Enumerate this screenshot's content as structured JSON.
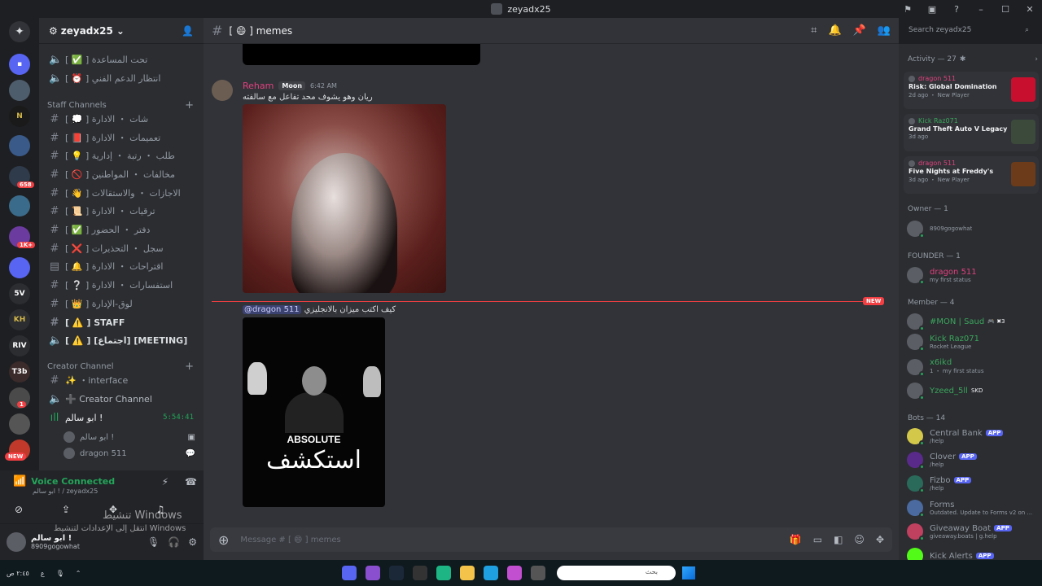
{
  "window": {
    "title": "zeyadx25",
    "controls": [
      "–",
      "☐",
      "✕"
    ]
  },
  "server_list": {
    "badges": [
      "658",
      "1K+",
      "1",
      "NEW"
    ],
    "labels": [
      "5V",
      "KH",
      "RIV",
      "T3b"
    ]
  },
  "guild": {
    "name": "zeyadx25",
    "channels_top": [
      {
        "type": "voice",
        "label": "[ ✅ ] تحت المساعدة"
      },
      {
        "type": "voice",
        "label": "[ ⏰ ] انتظار الدعم الفني"
      }
    ],
    "staff_category": "Staff Channels",
    "staff_channels": [
      {
        "label": "[ 💭 ] شات ・ الادارة"
      },
      {
        "label": "[ 📕 ] تعميمات ・ الادارة"
      },
      {
        "label": "[ 💡 ] طلب ・ رتبة ・ إدارية"
      },
      {
        "label": "[ 🚫 ] مخالفات ・ المواطنين"
      },
      {
        "label": "[ 👋 ] الاجازات ・ والاستقالات"
      },
      {
        "label": "[ 📜 ] ترقيات ・ الادارة"
      },
      {
        "label": "[ ✅ ] دفتر ・ الحضور"
      },
      {
        "label": "[ ❌ ] سجل ・ التحذيرات"
      },
      {
        "label": "[ 🔔 ] اقتراحات ・ الادارة"
      },
      {
        "label": "[ ❔ ] استفسارات ・ الادارة"
      },
      {
        "label": "[ 👑 ] لوق-الإدارة"
      },
      {
        "label": "[ ⚠️ ] STAFF"
      },
      {
        "label": "[ ⚠️ ] [اجتماع] [MEETING]"
      }
    ],
    "creator_category": "Creator Channel",
    "creator_channels": [
      {
        "type": "text",
        "label": "✨ ・interface"
      },
      {
        "type": "voice",
        "label": "➕ Creator Channel"
      },
      {
        "type": "voice-active",
        "label": "ابو سالم !",
        "timer": "5:54:41"
      }
    ],
    "voice_users": [
      {
        "name": "ابو سالم !"
      },
      {
        "name": "dragon 511"
      }
    ]
  },
  "voice_panel": {
    "status": "Voice Connected",
    "sub": "ابو سالم ! / zeyadx25"
  },
  "user_panel": {
    "name": "ابو سالم !",
    "status": "8909gogowhat"
  },
  "channel": {
    "name": "[ 😄 ] memes",
    "search_placeholder": "Search zeyadx25",
    "composer_placeholder": "Message # [ 😄 ] memes"
  },
  "messages": [
    {
      "author": "Reham",
      "role_tag": "Moon",
      "time": "6:42 AM",
      "text": "ريان وهو يشوف محد تفاعل مع سالفته"
    },
    {
      "mention": "@dragon 511",
      "text": "كيف اكتب ميزان بالانجليزي",
      "image_line1": "ABSOLUTE",
      "image_line2": "استكشف"
    }
  ],
  "new_tag": "NEW",
  "activity": {
    "title": "Activity — 27",
    "cards": [
      {
        "user": "dragon 511",
        "game": "Risk: Global Domination",
        "meta": "2d ago ・ New Player",
        "art_color": "#c8102e"
      },
      {
        "user": "Kick Raz071",
        "game": "Grand Theft Auto V Legacy",
        "meta": "3d ago",
        "art_color": "#3b4a3b"
      },
      {
        "user": "dragon 511",
        "game": "Five Nights at Freddy's",
        "meta": "3d ago ・ New Player",
        "art_color": "#6b3b1a"
      }
    ]
  },
  "member_groups": {
    "owner": {
      "title": "Owner — 1",
      "members": [
        {
          "name": "",
          "status": "8909gogowhat",
          "color": "#dbdee1"
        }
      ]
    },
    "founder": {
      "title": "FOUNDER — 1",
      "members": [
        {
          "name": "dragon 511",
          "status": "my first status",
          "color": "#e0407e"
        }
      ]
    },
    "member": {
      "title": "Member — 4",
      "members": [
        {
          "name": "#MON | Saud",
          "tag": "🎮 ✖3",
          "status": "",
          "color": "#3ba55c"
        },
        {
          "name": "Kick Raz071",
          "status": "Rocket League",
          "color": "#3ba55c"
        },
        {
          "name": "x6ikd",
          "status": "1 ・ my first status",
          "color": "#3ba55c"
        },
        {
          "name": "Yzeed_5ll",
          "tag": "SKD",
          "status": "",
          "color": "#3ba55c"
        }
      ]
    },
    "bots": {
      "title": "Bots — 14",
      "members": [
        {
          "name": "Central Bank",
          "status": "/help",
          "color": "#949ba4"
        },
        {
          "name": "Clover",
          "status": "/help",
          "color": "#949ba4"
        },
        {
          "name": "Fizbo",
          "status": "/help",
          "color": "#949ba4"
        },
        {
          "name": "Forms",
          "status": "Outdated. Update to Forms v2 on ...",
          "color": "#949ba4"
        },
        {
          "name": "Giveaway Boat",
          "status": "giveaway.boats | g.help",
          "color": "#949ba4"
        },
        {
          "name": "Kick Alerts",
          "status": "",
          "color": "#949ba4"
        }
      ]
    },
    "app_tag": "APP"
  },
  "watermark": {
    "line1": "تنشيط Windows",
    "line2": "انتقل إلى الإعدادات لتنشيط Windows"
  },
  "taskbar": {
    "search_placeholder": "بحث",
    "clock": "٢:٤٥ ص",
    "left_text": "ع"
  }
}
